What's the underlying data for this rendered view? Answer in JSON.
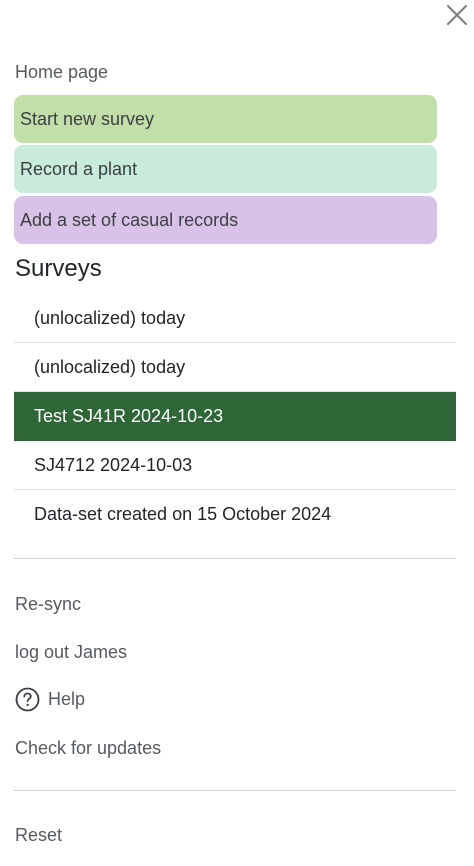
{
  "close": {
    "icon": "close-icon"
  },
  "menu": {
    "home_label": "Home page",
    "actions": [
      {
        "label": "Start new survey",
        "color": "#c3dfa9"
      },
      {
        "label": "Record a plant",
        "color": "#c9ebda"
      },
      {
        "label": "Add a set of casual records",
        "color": "#d9c2e8"
      }
    ]
  },
  "surveys": {
    "title": "Surveys",
    "active_color": "#2e6637",
    "items": [
      {
        "label": "(unlocalized) today",
        "active": false
      },
      {
        "label": "(unlocalized) today",
        "active": false
      },
      {
        "label": "Test SJ41R 2024-10-23",
        "active": true
      },
      {
        "label": "SJ4712 2024-10-03",
        "active": false
      },
      {
        "label": "Data-set created on 15 October 2024",
        "active": false
      }
    ]
  },
  "links": {
    "resync": "Re-sync",
    "logout": "log out James",
    "help": {
      "label": "Help",
      "icon": "help-circle-icon"
    },
    "updates": "Check for updates",
    "reset": "Reset"
  }
}
